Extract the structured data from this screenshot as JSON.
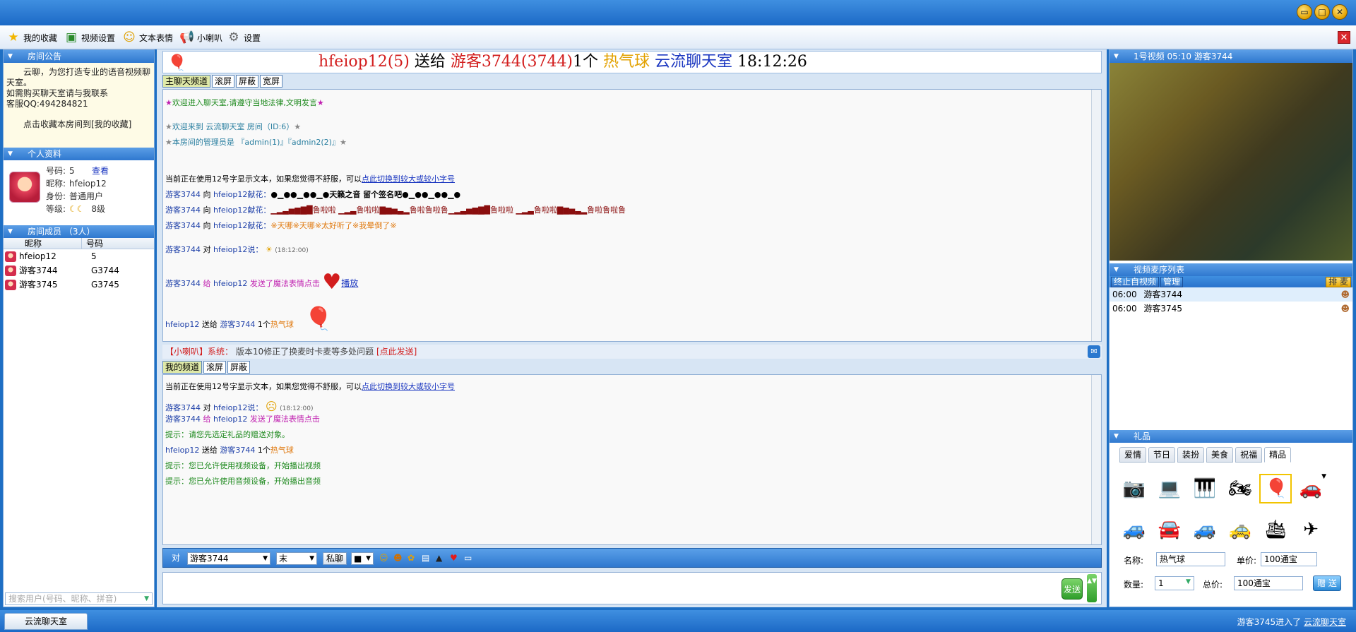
{
  "toolbar": {
    "favorites": "我的收藏",
    "video_settings": "视频设置",
    "emoji": "文本表情",
    "speaker": "小喇叭",
    "settings": "设置"
  },
  "left": {
    "notice_title": "房间公告",
    "notice_lines": [
      "云聊，为您打造专业的语音视频聊天室。",
      "如需购买聊天室请与我联系",
      "客服QQ:494284821",
      "点击收藏本房间到[我的收藏]"
    ],
    "profile_title": "个人资料",
    "profile": {
      "num_label": "号码:",
      "num": "5",
      "view": "查看",
      "nick_label": "昵称:",
      "nick": "hfeiop12",
      "role_label": "身份:",
      "role": "普通用户",
      "level_label": "等级:",
      "level": "8级"
    },
    "members_title": "房间成员 （3人）",
    "members_cols": [
      "昵称",
      "号码"
    ],
    "members": [
      {
        "name": "hfeiop12",
        "num": "5"
      },
      {
        "name": "游客3744",
        "num": "G3744"
      },
      {
        "name": "游客3745",
        "num": "G3745"
      }
    ],
    "search_placeholder": "搜索用户(号码、昵称、拼音)"
  },
  "banner": {
    "sender": "hfeiop12(5)",
    "verb": "送给",
    "receiver": "游客3744(3744)",
    "count": "1个",
    "gift": "热气球",
    "room": "云流聊天室",
    "time": "18:12:26"
  },
  "main_tabs": [
    "主聊天频道",
    "滚屏",
    "屏蔽",
    "宽屏"
  ],
  "main_chat": {
    "welcome": "欢迎进入聊天室,请遵守当地法律,文明发言",
    "welcome_room": "欢迎来到  云流聊天室  房间（ID:6）",
    "admins": "本房间的管理员是  『admin(1)』『admin2(2)』",
    "font_tip_pre": "当前正在使用12号字显示文本，如果您觉得不舒服，可以",
    "font_tip_link": "点此切换到较大或较小字号",
    "m1_user": "游客3744",
    "m1_mid": "向",
    "m1_target": "hfeiop12献花：",
    "m1_text": "●▁●●▁●●▁●天籁之音  留个签名吧●▁●●▁●●▁●",
    "m2_user": "游客3744",
    "m2_mid": "向",
    "m2_target": "hfeiop12献花：",
    "m2_text": "▁▂▃▅▆▇█鲁啦啦  ▁▂▃鲁啦啦▇▆▅▃▂鲁啦鲁啦鲁▁▂▃▅▆▇█鲁啦啦  ▁▂▃鲁啦啦▇▆▅▃▂鲁啦鲁啦鲁",
    "m3_user": "游客3744",
    "m3_mid": "向",
    "m3_target": "hfeiop12献花：",
    "m3_text": "※天哪※天哪※太好听了※我晕倒了※",
    "m4_user": "游客3744",
    "m4_mid": "对",
    "m4_target": "hfeiop12说：",
    "m4_time": "(18:12:00)",
    "m5_user": "游客3744",
    "m5_mid": "给",
    "m5_target": "hfeiop12",
    "m5_text": "发送了魔法表情点击",
    "m5_link": "播放",
    "m6_user": "hfeiop12",
    "m6_mid": "送给",
    "m6_target": "游客3744",
    "m6_count": "1个",
    "m6_gift": "热气球"
  },
  "sysbar": {
    "tag": "【小喇叭】系统：",
    "text": "版本10修正了换麦时卡麦等多处问题",
    "link": "[点此发送]"
  },
  "my_tabs": [
    "我的频道",
    "滚屏",
    "屏蔽"
  ],
  "my_chat": {
    "font_tip_pre": "当前正在使用12号字显示文本，如果您觉得不舒服，可以",
    "font_tip_link": "点此切换到较大或较小字号",
    "m1_user": "游客3744",
    "m1_mid": "对",
    "m1_target": "hfeiop12说：",
    "m1_time": "(18:12:00)",
    "m2_user": "游客3744",
    "m2_mid": "给",
    "m2_target": "hfeiop12",
    "m2_text": "发送了魔法表情点击",
    "hint1": "提示：请您先选定礼品的赠送对象。",
    "m3_user": "hfeiop12",
    "m3_mid": "送给",
    "m3_target": "游客3744",
    "m3_count": "1个",
    "m3_gift": "热气球",
    "hint2": "提示：您已允许使用视频设备，开始播出视频",
    "hint3": "提示：您已允许使用音频设备，开始播出音频"
  },
  "input": {
    "to_label": "对",
    "target": "游客3744",
    "font": "末",
    "private": "私聊",
    "color": "■",
    "send": "发送"
  },
  "right": {
    "video_title": "1号视频 05:10 游客3744",
    "queue_title": "视频麦序列表",
    "queue_stop": "终止自视频",
    "queue_mgr": "管理",
    "queue_order": "排 麦",
    "queue": [
      {
        "time": "06:00",
        "name": "游客3744"
      },
      {
        "time": "06:00",
        "name": "游客3745"
      }
    ],
    "gift_title": "礼品",
    "gift_tabs": [
      "爱情",
      "节日",
      "装扮",
      "美食",
      "祝福",
      "精品"
    ],
    "gifts": [
      "camera-icon",
      "laptop-icon",
      "piano-icon",
      "motorbike-icon",
      "balloon-icon",
      "car-icon",
      "minicar-icon",
      "car-icon",
      "suv-icon",
      "car-icon",
      "ship-icon",
      "plane-icon"
    ],
    "gift_glyphs": [
      "📷",
      "💻",
      "🎹",
      "🏍",
      "🎈",
      "🚗",
      "🚙",
      "🚘",
      "🚙",
      "🚕",
      "🛳",
      "✈"
    ],
    "name_label": "名称:",
    "name_value": "热气球",
    "price_label": "单价:",
    "price_value": "100通宝",
    "qty_label": "数量:",
    "qty_value": "1",
    "total_label": "总价:",
    "total_value": "100通宝",
    "give_btn": "赠 送"
  },
  "bottom": {
    "room_tab": "云流聊天室",
    "status_pre": "游客3745进入了",
    "status_room": "云流聊天室"
  }
}
